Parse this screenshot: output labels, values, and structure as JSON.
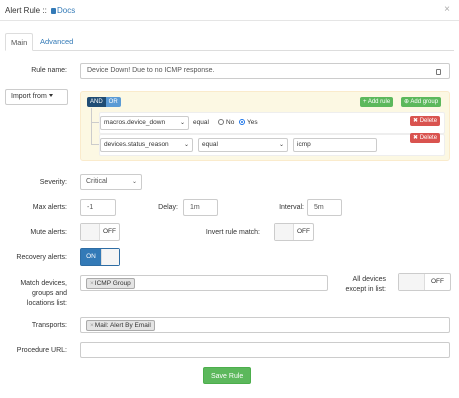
{
  "header": {
    "title": "Alert Rule :: ",
    "docs_label": "Docs",
    "close_glyph": "×"
  },
  "tabs": [
    {
      "label": "Main"
    },
    {
      "label": "Advanced"
    }
  ],
  "rule_name": {
    "label": "Rule name:",
    "value": "Device Down! Due to no ICMP response."
  },
  "import_from": {
    "label": "Import from"
  },
  "builder": {
    "and_label": "AND",
    "or_label": "OR",
    "add_rule": "+ Add rule",
    "add_group": "⊕ Add group",
    "rules": [
      {
        "field": "macros.device_down",
        "operator": "equal",
        "radio_no": "No",
        "radio_yes": "Yes",
        "selected": "Yes",
        "delete_label": "✖ Delete"
      },
      {
        "field": "devices.status_reason",
        "operator": "equal",
        "value": "icmp",
        "delete_label": "✖ Delete"
      }
    ]
  },
  "severity": {
    "label": "Severity:",
    "value": "Critical"
  },
  "max_alerts": {
    "label": "Max alerts:",
    "value": "-1"
  },
  "delay": {
    "label": "Delay:",
    "value": "1m"
  },
  "interval": {
    "label": "Interval:",
    "value": "5m"
  },
  "mute_alerts": {
    "label": "Mute alerts:",
    "state": "OFF"
  },
  "invert_rule": {
    "label": "Invert rule match:",
    "state": "OFF"
  },
  "recovery_alerts": {
    "label": "Recovery alerts:",
    "state": "ON"
  },
  "match_devices": {
    "label_lines": [
      "Match devices,",
      "groups and",
      "locations list:"
    ],
    "tags": [
      "ICMP Group"
    ]
  },
  "all_devices_except": {
    "label_lines": [
      "All devices",
      "except in list:"
    ],
    "state": "OFF"
  },
  "transports": {
    "label": "Transports:",
    "tags": [
      "Mail: Alert By Email"
    ]
  },
  "procedure_url": {
    "label": "Procedure URL:",
    "value": ""
  },
  "save_label": "Save Rule",
  "colors": {
    "link": "#337ab7",
    "success": "#5cb85c",
    "danger": "#d9534f",
    "builder_bg": "#fcf8e3"
  }
}
